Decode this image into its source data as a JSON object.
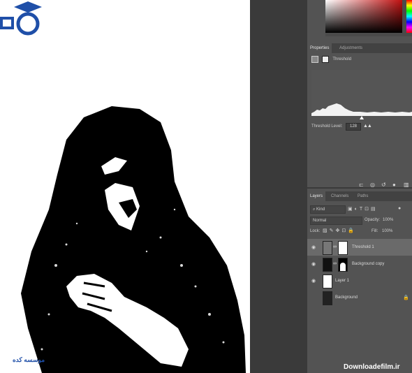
{
  "properties_panel": {
    "tabs": [
      {
        "label": "Properties",
        "active": true
      },
      {
        "label": "Adjustments",
        "active": false
      }
    ],
    "adjustment_name": "Threshold",
    "threshold_level_label": "Threshold Level:",
    "threshold_level_value": "128"
  },
  "layers_panel": {
    "tabs": [
      {
        "label": "Layers",
        "active": true
      },
      {
        "label": "Channels",
        "active": false
      },
      {
        "label": "Paths",
        "active": false
      }
    ],
    "filter_kind": "Kind",
    "blend_mode": "Normal",
    "opacity_label": "Opacity:",
    "opacity_value": "100%",
    "lock_label": "Lock:",
    "fill_label": "Fill:",
    "fill_value": "100%",
    "layers": [
      {
        "name": "Threshold 1",
        "active": true,
        "visible": true
      },
      {
        "name": "Background copy",
        "active": false,
        "visible": true
      },
      {
        "name": "Layer 1",
        "active": false,
        "visible": true
      },
      {
        "name": "Background",
        "active": false,
        "visible": false,
        "locked": true
      }
    ]
  },
  "watermark": "Downloadefilm.ir",
  "logo_text": "موسسه کده",
  "colors": {
    "panel_bg": "#535353",
    "workspace_bg": "#3a3a3a",
    "canvas_bg": "#ffffff",
    "logo_blue": "#1f4fa8"
  }
}
